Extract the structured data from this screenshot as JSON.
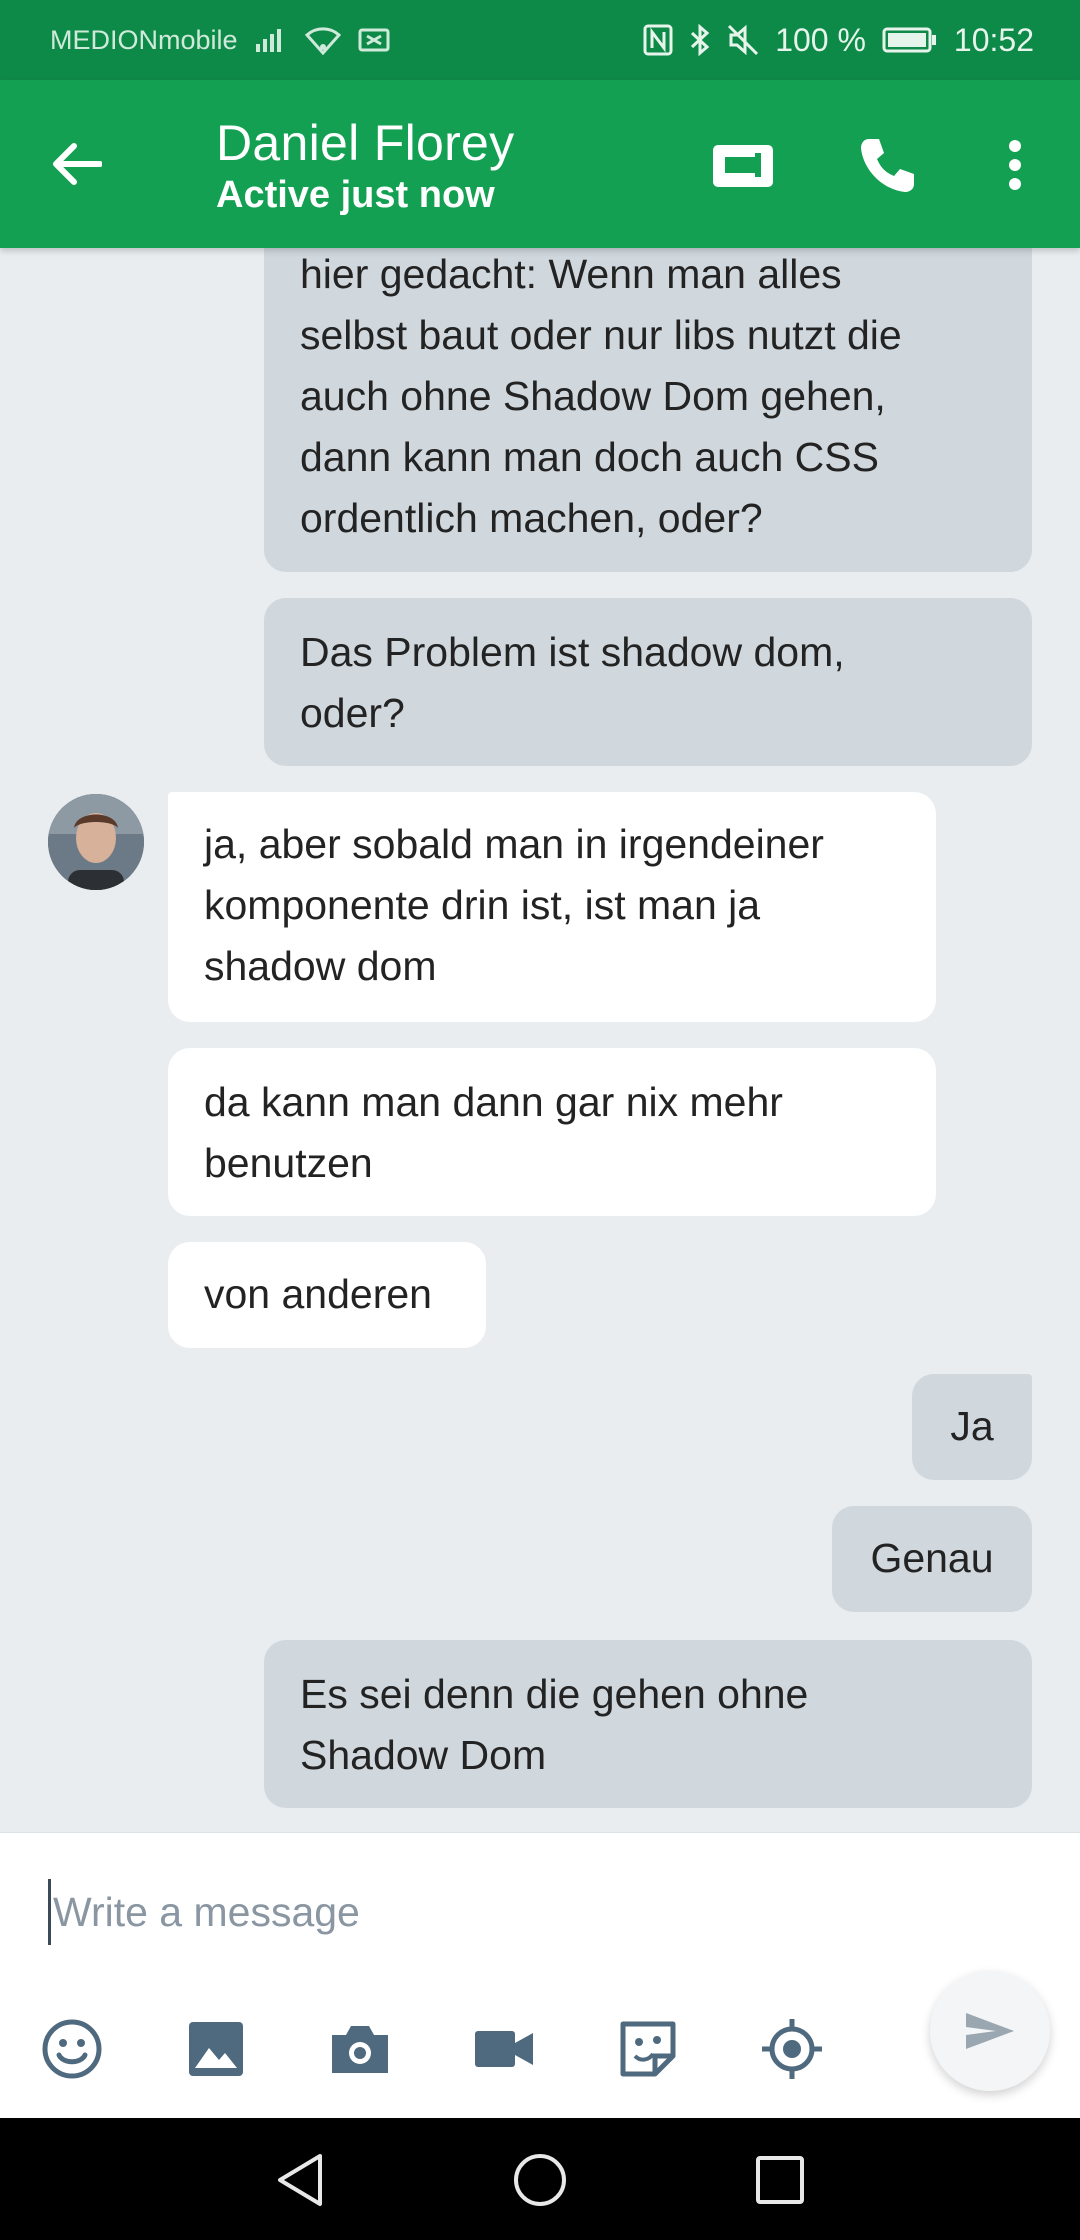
{
  "status_bar": {
    "carrier": "MEDIONmobile",
    "battery": "100 %",
    "time": "10:52"
  },
  "header": {
    "contact_name": "Daniel Florey",
    "contact_status": "Active just now",
    "icons": {
      "back": "arrow-left-icon",
      "video": "videocam-icon",
      "call": "phone-icon",
      "menu": "more-vert-icon"
    }
  },
  "messages": [
    {
      "direction": "out",
      "text": "hier gedacht: Wenn man alles\nselbst baut oder nur libs nutzt die\nauch ohne Shadow Dom gehen,\ndann kann man doch auch CSS\nordentlich machen, oder?"
    },
    {
      "direction": "out",
      "text": "Das Problem ist shadow dom,\noder?"
    },
    {
      "direction": "in",
      "text": "ja, aber sobald man in irgendeiner\nkomponente drin ist, ist man ja\nshadow dom"
    },
    {
      "direction": "in",
      "text": "da kann man dann gar nix mehr\nbenutzen"
    },
    {
      "direction": "in",
      "text": "von anderen"
    },
    {
      "direction": "out",
      "text": "Ja"
    },
    {
      "direction": "out",
      "text": "Genau"
    },
    {
      "direction": "out",
      "text": "Es sei denn die gehen ohne\nShadow Dom"
    }
  ],
  "composer": {
    "placeholder": "Write a message",
    "value": "",
    "tools": [
      "emoji-icon",
      "image-icon",
      "camera-icon",
      "video-icon",
      "sticker-icon",
      "location-icon"
    ],
    "send": "send-icon"
  },
  "colors": {
    "status_bar": "#0e8a48",
    "app_bar": "#13a052",
    "outgoing_bubble": "#d0d8de",
    "incoming_bubble": "#ffffff",
    "background": "#e9edf0"
  }
}
